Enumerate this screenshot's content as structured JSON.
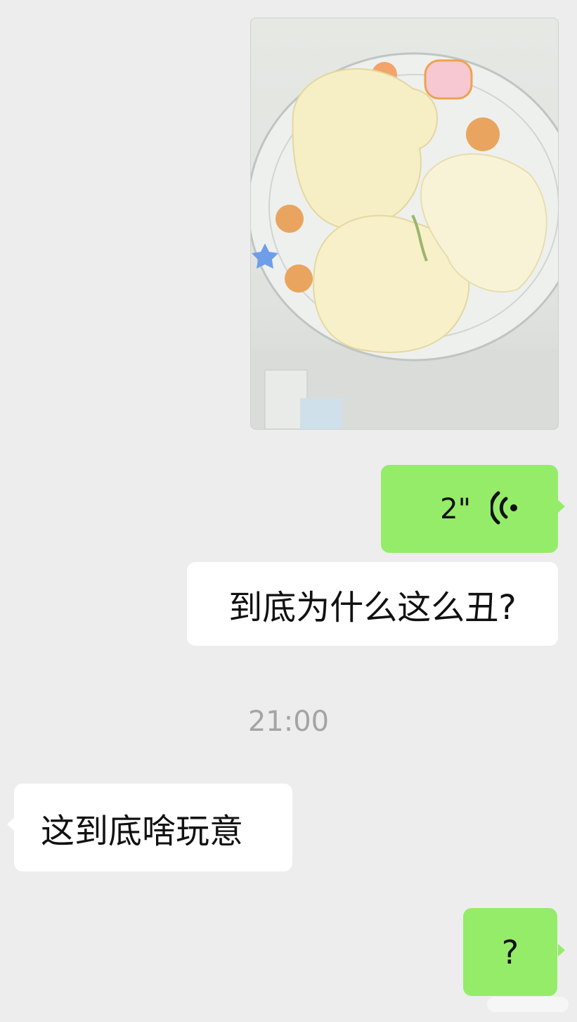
{
  "messages": {
    "photo": {
      "icon": "steamed-buns-photo"
    },
    "voice": {
      "duration": "2\"",
      "icon": "voice-wave-icon"
    },
    "text_outgoing_1": "到底为什么这么丑?",
    "timestamp": "21:00",
    "text_incoming_1": "这到底啥玩意",
    "text_outgoing_2": "?"
  },
  "colors": {
    "background": "#ededed",
    "outgoing_bubble": "#95ec69",
    "incoming_bubble": "#ffffff",
    "timestamp_text": "#a4a4a4"
  }
}
